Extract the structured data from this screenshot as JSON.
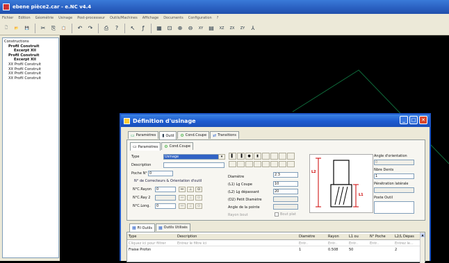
{
  "window": {
    "title": "ebene pièce2.car - e.NC v4.4"
  },
  "menu": [
    "Fichier",
    "Edition",
    "Géométrie",
    "Usinage",
    "Post-processeur",
    "Outils/Machines",
    "Affichage",
    "Documents",
    "Configuration",
    "?"
  ],
  "toolbar_icons": [
    "new-file-icon",
    "open-folder-icon",
    "save-icon",
    "cut-icon",
    "copy-icon",
    "paste-icon",
    "undo-icon",
    "redo-icon",
    "print-icon",
    "help-icon",
    "pointer-icon",
    "function-icon",
    "grid-icon",
    "zoom-window-icon",
    "zoom-in-icon",
    "zoom-out-icon",
    "view-xy-icon",
    "view-side-icon",
    "view-xz-icon",
    "view-zx-icon",
    "view-zy-icon",
    "view-3d-icon"
  ],
  "tree": {
    "items": [
      {
        "label": "Constructions",
        "level": 0,
        "bold": false
      },
      {
        "label": "Profil Construit",
        "level": 1,
        "bold": true
      },
      {
        "label": "Excerpt XII",
        "level": 2,
        "bold": true
      },
      {
        "label": "Profil Construit",
        "level": 1,
        "bold": true
      },
      {
        "label": "Excerpt XII",
        "level": 2,
        "bold": true
      },
      {
        "label": "XX Profil Construit",
        "level": 1,
        "bold": false
      },
      {
        "label": "XX Profil Construit",
        "level": 1,
        "bold": false
      },
      {
        "label": "XX Profil Construit",
        "level": 1,
        "bold": false
      },
      {
        "label": "XX Profil Construit",
        "level": 1,
        "bold": false
      }
    ]
  },
  "dialog": {
    "title": "Définition d'usinage",
    "tabs": [
      "Paramètres",
      "Outil",
      "Cond.Coupe",
      "Transitions"
    ],
    "subtabs": [
      "Paramètres",
      "Cond.Coupe"
    ],
    "fields": {
      "type_label": "Type",
      "type_value": "Usinage",
      "description_label": "Description",
      "poche_label": "Poche N°",
      "poche_value": "0",
      "note_correcteurs": "N° de Correcteurs & Orientation d'outil",
      "ncr_rayon_label": "N°C.Rayon",
      "ncr_rayon_value": "0",
      "ncr_rayon2_label": "N°C.Ray 2",
      "ncl_long_label": "N°C.Long.",
      "ncl_long_value": "0"
    },
    "tool_params": {
      "diametre_label": "Diamètre",
      "diametre_value": "2.3",
      "lg_coupe_label": "(L1) Lg Coupe",
      "lg_coupe_value": "10",
      "lg_depassant_label": "(L2) Lg dépassant",
      "lg_depassant_value": "20",
      "petit_diametre_label": "(D2) Petit Diamètre",
      "angle_pointe_label": "Angle de la pointe",
      "rayon_bout_label": "Rayon bout",
      "checkbox_label": "Bout plat"
    },
    "right_params": {
      "angle_orientation_label": "Angle d'orientation",
      "angle_orientation_value": "0",
      "nbre_dents_label": "Nbre Dents",
      "nbre_dents_value": "1",
      "penetration_label": "Pénétration latérale",
      "poste_outil_label": "Poste Outil"
    },
    "diagram_labels": {
      "l1": "L1",
      "l2": "L2"
    },
    "bottom_tabs": [
      "Fil Outils",
      "Outils Utilisés"
    ],
    "grid": {
      "columns": [
        "Type",
        "Description",
        "Diamètre",
        "Rayon",
        "L1 ou",
        "N° Poche",
        "L2/L Dépas"
      ],
      "filters": [
        "Cliquez ici pour filtrer",
        "Entrez le filtre ici",
        "Entr..",
        "Entr..",
        "Entr..",
        "Entr..",
        "Entrez le..."
      ],
      "row": [
        "Fraise Profon",
        "",
        "1",
        "0.508",
        "50",
        "",
        "2"
      ]
    }
  }
}
